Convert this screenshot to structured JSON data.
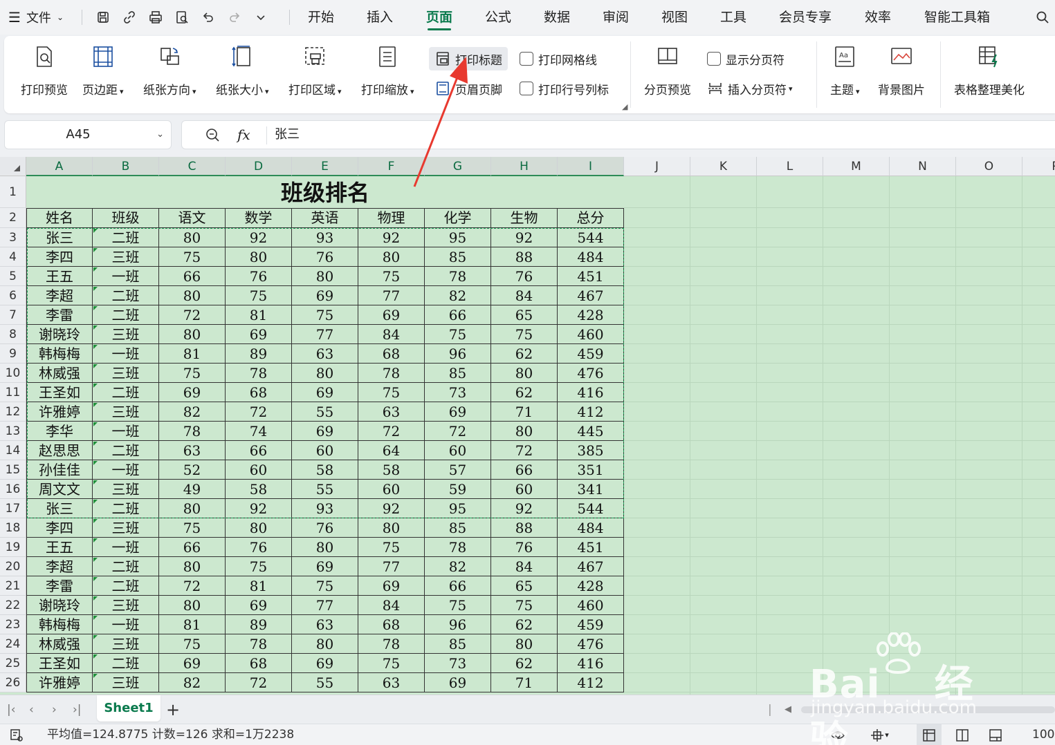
{
  "menubar": {
    "file_label": "文件",
    "tabs": [
      {
        "label": "开始",
        "active": false
      },
      {
        "label": "插入",
        "active": false
      },
      {
        "label": "页面",
        "active": true
      },
      {
        "label": "公式",
        "active": false
      },
      {
        "label": "数据",
        "active": false
      },
      {
        "label": "审阅",
        "active": false
      },
      {
        "label": "视图",
        "active": false
      },
      {
        "label": "工具",
        "active": false
      },
      {
        "label": "会员专享",
        "active": false
      },
      {
        "label": "效率",
        "active": false
      },
      {
        "label": "智能工具箱",
        "active": false
      }
    ]
  },
  "ribbon": {
    "print_preview": "打印预览",
    "margins": "页边距",
    "orientation": "纸张方向",
    "paper_size": "纸张大小",
    "print_area": "打印区域",
    "print_scale": "打印缩放",
    "print_titles": "打印标题",
    "header_footer": "页眉页脚",
    "print_gridlines": "打印网格线",
    "print_row_col_headers": "打印行号列标",
    "page_break_preview": "分页预览",
    "show_page_breaks": "显示分页符",
    "insert_page_break": "插入分页符",
    "theme": "主题",
    "background_image": "背景图片",
    "table_beautify": "表格整理美化"
  },
  "formula_bar": {
    "cell_ref": "A45",
    "formula": "张三"
  },
  "grid": {
    "columns": [
      "A",
      "B",
      "C",
      "D",
      "E",
      "F",
      "G",
      "H",
      "I",
      "J",
      "K",
      "L",
      "M",
      "N",
      "O",
      "P"
    ],
    "row_numbers": [
      "1",
      "2",
      "3",
      "4",
      "5",
      "6",
      "7",
      "8",
      "9",
      "10",
      "11",
      "12",
      "13",
      "14",
      "15",
      "16",
      "17",
      "18",
      "19",
      "20",
      "21",
      "22",
      "23",
      "24",
      "25",
      "26"
    ],
    "title": "班级排名",
    "headers": [
      "姓名",
      "班级",
      "语文",
      "数学",
      "英语",
      "物理",
      "化学",
      "生物",
      "总分"
    ],
    "rows": [
      [
        "张三",
        "二班",
        "80",
        "92",
        "93",
        "92",
        "95",
        "92",
        "544"
      ],
      [
        "李四",
        "三班",
        "75",
        "80",
        "76",
        "80",
        "85",
        "88",
        "484"
      ],
      [
        "王五",
        "一班",
        "66",
        "76",
        "80",
        "75",
        "78",
        "76",
        "451"
      ],
      [
        "李超",
        "二班",
        "80",
        "75",
        "69",
        "77",
        "82",
        "84",
        "467"
      ],
      [
        "李雷",
        "二班",
        "72",
        "81",
        "75",
        "69",
        "66",
        "65",
        "428"
      ],
      [
        "谢晓玲",
        "三班",
        "80",
        "69",
        "77",
        "84",
        "75",
        "75",
        "460"
      ],
      [
        "韩梅梅",
        "一班",
        "81",
        "89",
        "63",
        "68",
        "96",
        "62",
        "459"
      ],
      [
        "林威强",
        "三班",
        "75",
        "78",
        "80",
        "78",
        "85",
        "80",
        "476"
      ],
      [
        "王圣如",
        "二班",
        "69",
        "68",
        "69",
        "75",
        "73",
        "62",
        "416"
      ],
      [
        "许雅婷",
        "三班",
        "82",
        "72",
        "55",
        "63",
        "69",
        "71",
        "412"
      ],
      [
        "李华",
        "一班",
        "78",
        "74",
        "69",
        "72",
        "72",
        "80",
        "445"
      ],
      [
        "赵思思",
        "二班",
        "63",
        "66",
        "60",
        "64",
        "60",
        "72",
        "385"
      ],
      [
        "孙佳佳",
        "一班",
        "52",
        "60",
        "58",
        "58",
        "57",
        "66",
        "351"
      ],
      [
        "周文文",
        "三班",
        "49",
        "58",
        "55",
        "60",
        "59",
        "60",
        "341"
      ],
      [
        "张三",
        "二班",
        "80",
        "92",
        "93",
        "92",
        "95",
        "92",
        "544"
      ],
      [
        "李四",
        "三班",
        "75",
        "80",
        "76",
        "80",
        "85",
        "88",
        "484"
      ],
      [
        "王五",
        "一班",
        "66",
        "76",
        "80",
        "75",
        "78",
        "76",
        "451"
      ],
      [
        "李超",
        "二班",
        "80",
        "75",
        "69",
        "77",
        "82",
        "84",
        "467"
      ],
      [
        "李雷",
        "二班",
        "72",
        "81",
        "75",
        "69",
        "66",
        "65",
        "428"
      ],
      [
        "谢晓玲",
        "三班",
        "80",
        "69",
        "77",
        "84",
        "75",
        "75",
        "460"
      ],
      [
        "韩梅梅",
        "一班",
        "81",
        "89",
        "63",
        "68",
        "96",
        "62",
        "459"
      ],
      [
        "林威强",
        "三班",
        "75",
        "78",
        "80",
        "78",
        "85",
        "80",
        "476"
      ],
      [
        "王圣如",
        "二班",
        "69",
        "68",
        "69",
        "75",
        "73",
        "62",
        "416"
      ],
      [
        "许雅婷",
        "三班",
        "82",
        "72",
        "55",
        "63",
        "69",
        "71",
        "412"
      ]
    ]
  },
  "sheets": {
    "active": "Sheet1"
  },
  "status": {
    "stats": "平均值=124.8775  计数=126  求和=1万2238",
    "zoom": "100"
  },
  "watermark": {
    "brand": "Bai",
    "brand_cn": "经验",
    "url": "jingyan.baidu.com"
  },
  "colors": {
    "accent": "#0a7a4d",
    "sheet_bg": "#cce8cf",
    "page_break": "#1ea35a",
    "annotation_arrow": "#e8392f"
  }
}
